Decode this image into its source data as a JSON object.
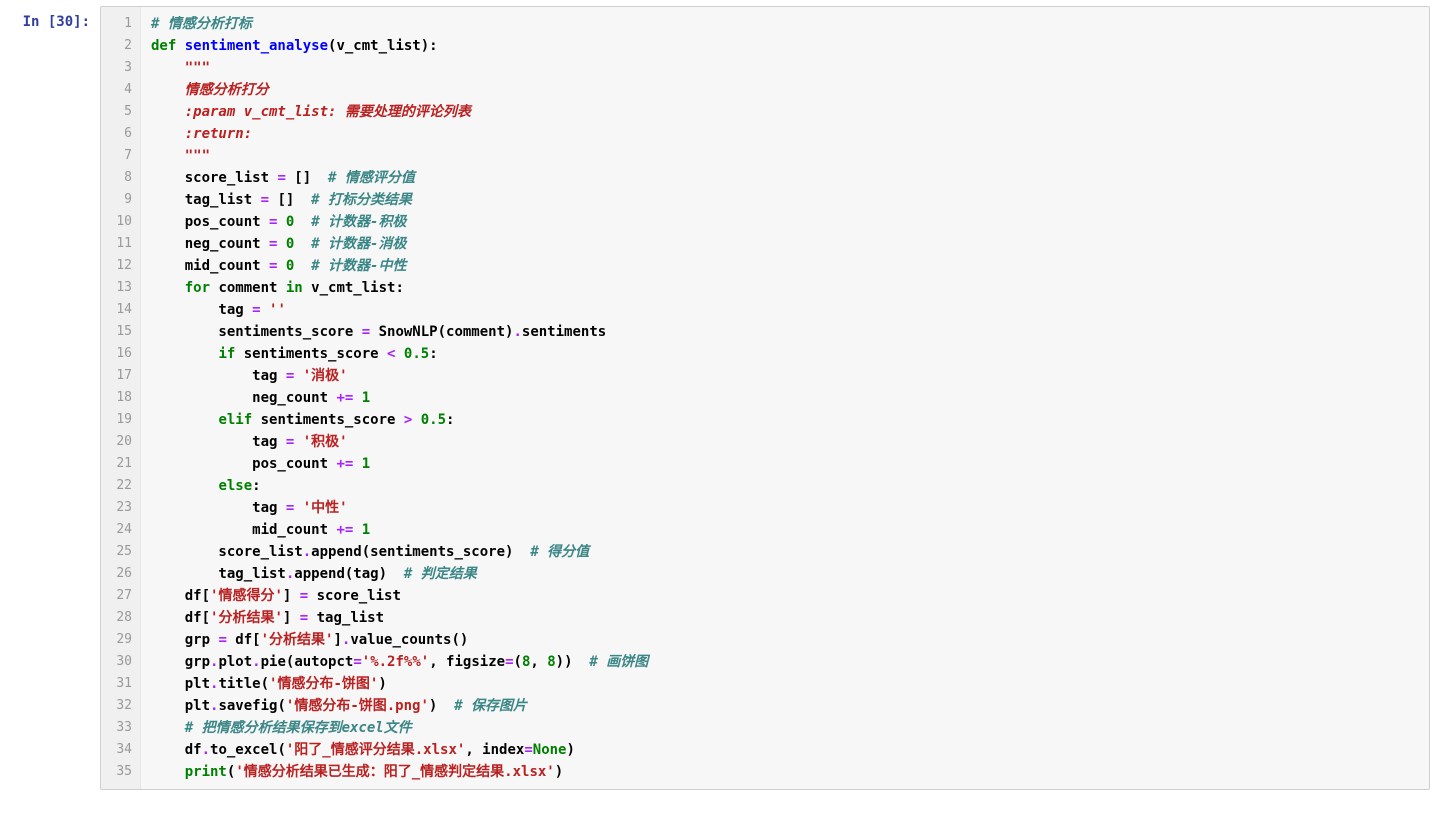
{
  "prompt": "In [30]:",
  "line_count": 35,
  "code_lines": [
    [
      {
        "t": "# 情感分析打标",
        "c": "tok-comment"
      }
    ],
    [
      {
        "t": "def ",
        "c": "tok-keyword"
      },
      {
        "t": "sentiment_analyse",
        "c": "tok-defname"
      },
      {
        "t": "(v_cmt_list):",
        "c": ""
      }
    ],
    [
      {
        "t": "    ",
        "c": ""
      },
      {
        "t": "\"\"\"",
        "c": "tok-docstr"
      }
    ],
    [
      {
        "t": "    ",
        "c": ""
      },
      {
        "t": "情感分析打分",
        "c": "tok-docstr"
      }
    ],
    [
      {
        "t": "    ",
        "c": ""
      },
      {
        "t": ":param v_cmt_list: 需要处理的评论列表",
        "c": "tok-docstr"
      }
    ],
    [
      {
        "t": "    ",
        "c": ""
      },
      {
        "t": ":return:",
        "c": "tok-docstr"
      }
    ],
    [
      {
        "t": "    ",
        "c": ""
      },
      {
        "t": "\"\"\"",
        "c": "tok-docstr"
      }
    ],
    [
      {
        "t": "    score_list ",
        "c": ""
      },
      {
        "t": "=",
        "c": "tok-op"
      },
      {
        "t": " []  ",
        "c": ""
      },
      {
        "t": "# 情感评分值",
        "c": "tok-comment"
      }
    ],
    [
      {
        "t": "    tag_list ",
        "c": ""
      },
      {
        "t": "=",
        "c": "tok-op"
      },
      {
        "t": " []  ",
        "c": ""
      },
      {
        "t": "# 打标分类结果",
        "c": "tok-comment"
      }
    ],
    [
      {
        "t": "    pos_count ",
        "c": ""
      },
      {
        "t": "=",
        "c": "tok-op"
      },
      {
        "t": " ",
        "c": ""
      },
      {
        "t": "0",
        "c": "tok-number"
      },
      {
        "t": "  ",
        "c": ""
      },
      {
        "t": "# 计数器-积极",
        "c": "tok-comment"
      }
    ],
    [
      {
        "t": "    neg_count ",
        "c": ""
      },
      {
        "t": "=",
        "c": "tok-op"
      },
      {
        "t": " ",
        "c": ""
      },
      {
        "t": "0",
        "c": "tok-number"
      },
      {
        "t": "  ",
        "c": ""
      },
      {
        "t": "# 计数器-消极",
        "c": "tok-comment"
      }
    ],
    [
      {
        "t": "    mid_count ",
        "c": ""
      },
      {
        "t": "=",
        "c": "tok-op"
      },
      {
        "t": " ",
        "c": ""
      },
      {
        "t": "0",
        "c": "tok-number"
      },
      {
        "t": "  ",
        "c": ""
      },
      {
        "t": "# 计数器-中性",
        "c": "tok-comment"
      }
    ],
    [
      {
        "t": "    ",
        "c": ""
      },
      {
        "t": "for",
        "c": "tok-keyword"
      },
      {
        "t": " comment ",
        "c": ""
      },
      {
        "t": "in",
        "c": "tok-keyword"
      },
      {
        "t": " v_cmt_list:",
        "c": ""
      }
    ],
    [
      {
        "t": "        tag ",
        "c": ""
      },
      {
        "t": "=",
        "c": "tok-op"
      },
      {
        "t": " ",
        "c": ""
      },
      {
        "t": "''",
        "c": "tok-string"
      }
    ],
    [
      {
        "t": "        sentiments_score ",
        "c": ""
      },
      {
        "t": "=",
        "c": "tok-op"
      },
      {
        "t": " SnowNLP(comment)",
        "c": ""
      },
      {
        "t": ".",
        "c": "tok-op"
      },
      {
        "t": "sentiments",
        "c": ""
      }
    ],
    [
      {
        "t": "        ",
        "c": ""
      },
      {
        "t": "if",
        "c": "tok-keyword"
      },
      {
        "t": " sentiments_score ",
        "c": ""
      },
      {
        "t": "<",
        "c": "tok-op"
      },
      {
        "t": " ",
        "c": ""
      },
      {
        "t": "0.5",
        "c": "tok-number"
      },
      {
        "t": ":",
        "c": ""
      }
    ],
    [
      {
        "t": "            tag ",
        "c": ""
      },
      {
        "t": "=",
        "c": "tok-op"
      },
      {
        "t": " ",
        "c": ""
      },
      {
        "t": "'消极'",
        "c": "tok-string"
      }
    ],
    [
      {
        "t": "            neg_count ",
        "c": ""
      },
      {
        "t": "+=",
        "c": "tok-op"
      },
      {
        "t": " ",
        "c": ""
      },
      {
        "t": "1",
        "c": "tok-number"
      }
    ],
    [
      {
        "t": "        ",
        "c": ""
      },
      {
        "t": "elif",
        "c": "tok-keyword"
      },
      {
        "t": " sentiments_score ",
        "c": ""
      },
      {
        "t": ">",
        "c": "tok-op"
      },
      {
        "t": " ",
        "c": ""
      },
      {
        "t": "0.5",
        "c": "tok-number"
      },
      {
        "t": ":",
        "c": ""
      }
    ],
    [
      {
        "t": "            tag ",
        "c": ""
      },
      {
        "t": "=",
        "c": "tok-op"
      },
      {
        "t": " ",
        "c": ""
      },
      {
        "t": "'积极'",
        "c": "tok-string"
      }
    ],
    [
      {
        "t": "            pos_count ",
        "c": ""
      },
      {
        "t": "+=",
        "c": "tok-op"
      },
      {
        "t": " ",
        "c": ""
      },
      {
        "t": "1",
        "c": "tok-number"
      }
    ],
    [
      {
        "t": "        ",
        "c": ""
      },
      {
        "t": "else",
        "c": "tok-keyword"
      },
      {
        "t": ":",
        "c": ""
      }
    ],
    [
      {
        "t": "            tag ",
        "c": ""
      },
      {
        "t": "=",
        "c": "tok-op"
      },
      {
        "t": " ",
        "c": ""
      },
      {
        "t": "'中性'",
        "c": "tok-string"
      }
    ],
    [
      {
        "t": "            mid_count ",
        "c": ""
      },
      {
        "t": "+=",
        "c": "tok-op"
      },
      {
        "t": " ",
        "c": ""
      },
      {
        "t": "1",
        "c": "tok-number"
      }
    ],
    [
      {
        "t": "        score_list",
        "c": ""
      },
      {
        "t": ".",
        "c": "tok-op"
      },
      {
        "t": "append(sentiments_score)  ",
        "c": ""
      },
      {
        "t": "# 得分值",
        "c": "tok-comment"
      }
    ],
    [
      {
        "t": "        tag_list",
        "c": ""
      },
      {
        "t": ".",
        "c": "tok-op"
      },
      {
        "t": "append(tag)  ",
        "c": ""
      },
      {
        "t": "# 判定结果",
        "c": "tok-comment"
      }
    ],
    [
      {
        "t": "    df[",
        "c": ""
      },
      {
        "t": "'情感得分'",
        "c": "tok-string"
      },
      {
        "t": "] ",
        "c": ""
      },
      {
        "t": "=",
        "c": "tok-op"
      },
      {
        "t": " score_list",
        "c": ""
      }
    ],
    [
      {
        "t": "    df[",
        "c": ""
      },
      {
        "t": "'分析结果'",
        "c": "tok-string"
      },
      {
        "t": "] ",
        "c": ""
      },
      {
        "t": "=",
        "c": "tok-op"
      },
      {
        "t": " tag_list",
        "c": ""
      }
    ],
    [
      {
        "t": "    grp ",
        "c": ""
      },
      {
        "t": "=",
        "c": "tok-op"
      },
      {
        "t": " df[",
        "c": ""
      },
      {
        "t": "'分析结果'",
        "c": "tok-string"
      },
      {
        "t": "]",
        "c": ""
      },
      {
        "t": ".",
        "c": "tok-op"
      },
      {
        "t": "value_counts()",
        "c": ""
      }
    ],
    [
      {
        "t": "    grp",
        "c": ""
      },
      {
        "t": ".",
        "c": "tok-op"
      },
      {
        "t": "plot",
        "c": ""
      },
      {
        "t": ".",
        "c": "tok-op"
      },
      {
        "t": "pie(autopct",
        "c": ""
      },
      {
        "t": "=",
        "c": "tok-op"
      },
      {
        "t": "'%.2f%%'",
        "c": "tok-string"
      },
      {
        "t": ", figsize",
        "c": ""
      },
      {
        "t": "=",
        "c": "tok-op"
      },
      {
        "t": "(",
        "c": ""
      },
      {
        "t": "8",
        "c": "tok-number"
      },
      {
        "t": ", ",
        "c": ""
      },
      {
        "t": "8",
        "c": "tok-number"
      },
      {
        "t": "))  ",
        "c": ""
      },
      {
        "t": "# 画饼图",
        "c": "tok-comment"
      }
    ],
    [
      {
        "t": "    plt",
        "c": ""
      },
      {
        "t": ".",
        "c": "tok-op"
      },
      {
        "t": "title(",
        "c": ""
      },
      {
        "t": "'情感分布-饼图'",
        "c": "tok-string"
      },
      {
        "t": ")",
        "c": ""
      }
    ],
    [
      {
        "t": "    plt",
        "c": ""
      },
      {
        "t": ".",
        "c": "tok-op"
      },
      {
        "t": "savefig(",
        "c": ""
      },
      {
        "t": "'情感分布-饼图.png'",
        "c": "tok-string"
      },
      {
        "t": ")  ",
        "c": ""
      },
      {
        "t": "# 保存图片",
        "c": "tok-comment"
      }
    ],
    [
      {
        "t": "    ",
        "c": ""
      },
      {
        "t": "# 把情感分析结果保存到excel文件",
        "c": "tok-comment"
      }
    ],
    [
      {
        "t": "    df",
        "c": ""
      },
      {
        "t": ".",
        "c": "tok-op"
      },
      {
        "t": "to_excel(",
        "c": ""
      },
      {
        "t": "'阳了_情感评分结果.xlsx'",
        "c": "tok-string"
      },
      {
        "t": ", index",
        "c": ""
      },
      {
        "t": "=",
        "c": "tok-op"
      },
      {
        "t": "None",
        "c": "tok-const"
      },
      {
        "t": ")",
        "c": ""
      }
    ],
    [
      {
        "t": "    ",
        "c": ""
      },
      {
        "t": "print",
        "c": "tok-builtin"
      },
      {
        "t": "(",
        "c": ""
      },
      {
        "t": "'情感分析结果已生成：阳了_情感判定结果.xlsx'",
        "c": "tok-string"
      },
      {
        "t": ")",
        "c": ""
      }
    ]
  ]
}
